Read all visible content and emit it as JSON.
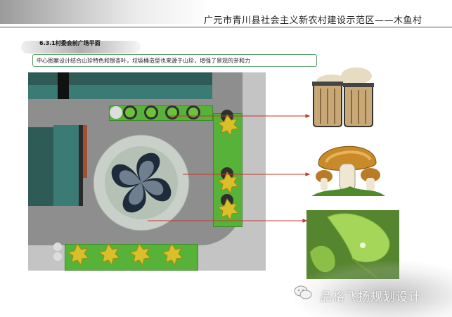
{
  "header": {
    "title": "广元市青川县社会主义新农村建设示范区——木鱼村"
  },
  "section": {
    "title": "6.3.1村委会前广场平面"
  },
  "description": {
    "text": "中心图案设计结合山珍特色和银杏叶，垃圾桶造型也来源于山珍，增强了景观的亲和力"
  },
  "watermark": {
    "text": "品格飞扬规划设计",
    "icon": "wechat-icon"
  },
  "images": [
    {
      "name": "mushroom-trash-bins",
      "subject": "trash bins with mushroom caps"
    },
    {
      "name": "mushroom",
      "subject": "mushroom"
    },
    {
      "name": "ginkgo-leaf-photo",
      "subject": "ginkgo leaf"
    }
  ],
  "colors": {
    "header_rule": "#555555",
    "desc_border": "#5aa06a",
    "leader_line": "#c0392b",
    "lawn": "#57b23a",
    "roof": "#2f5b56"
  }
}
